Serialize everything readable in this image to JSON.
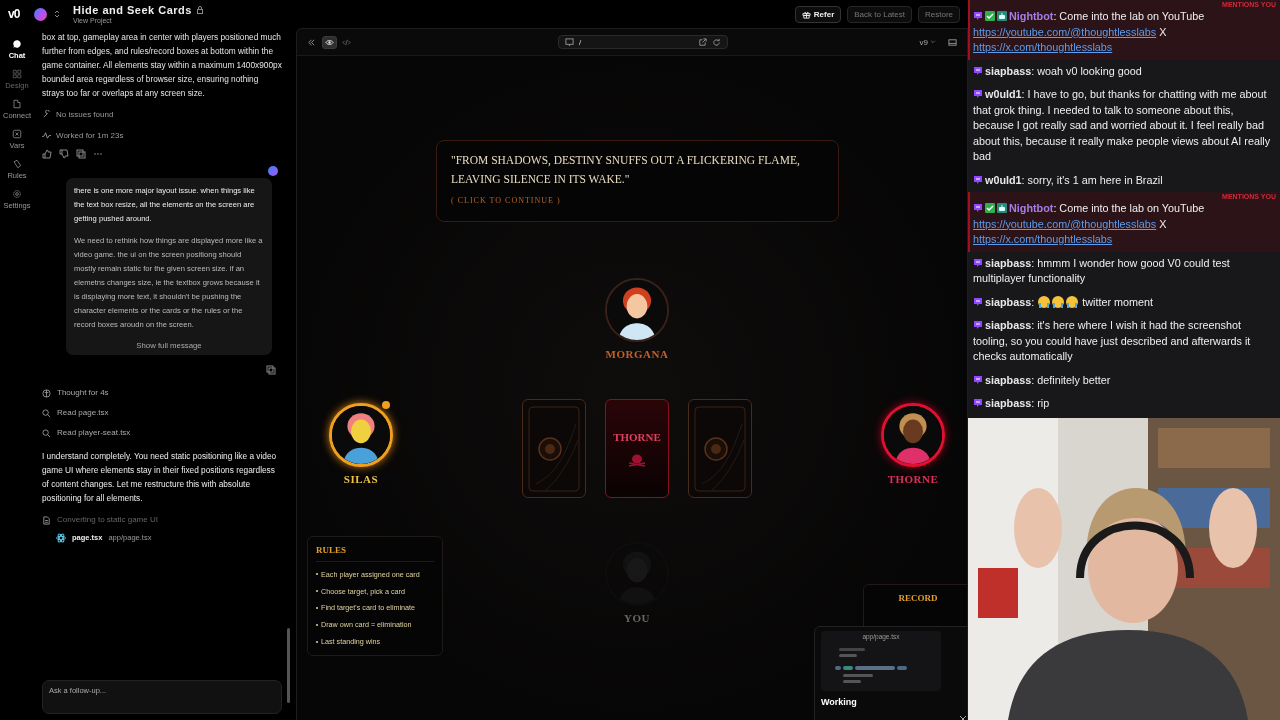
{
  "header": {
    "logo": "v0",
    "project_title": "Hide and Seek Cards",
    "project_link": "View Project",
    "buttons": [
      {
        "label": "Refer",
        "kind": "gift",
        "disabled": false
      },
      {
        "label": "Back to Latest",
        "kind": "plain",
        "disabled": true
      },
      {
        "label": "Restore",
        "kind": "plain",
        "disabled": true
      }
    ]
  },
  "nav": [
    {
      "label": "Chat",
      "kind": "chat",
      "selected": true,
      "disabled": false
    },
    {
      "label": "Design",
      "kind": "design",
      "selected": false,
      "disabled": true
    },
    {
      "label": "Connect",
      "kind": "connect",
      "selected": false,
      "disabled": false
    },
    {
      "label": "Vars",
      "kind": "vars",
      "selected": false,
      "disabled": false
    },
    {
      "label": "Rules",
      "kind": "rules",
      "selected": false,
      "disabled": false
    },
    {
      "label": "Settings",
      "kind": "settings",
      "selected": false,
      "disabled": false
    }
  ],
  "chat": {
    "summary": "box at top, gameplay area in center with players positioned much further from edges, and rules/record boxes at bottom within the game container. All elements stay within a maximum 1400x900px bounded area regardless of browser size, ensuring nothing strays too far or overlaps at any screen size.",
    "status": [
      {
        "kind": "wrench",
        "text": "No issues found"
      },
      {
        "kind": "pulse",
        "text": "Worked for 1m 23s"
      }
    ],
    "user_message": {
      "paragraphs": [
        "there is one more major layout issue. when things like the text box resize, all the elements on the screen are getting pushed around.",
        "We need to rethink how things are displayed more like a video game. the ui on the screen positiong should mostly remain static for the given screen size. if an elemetns changes size, ie the textbox grows because it is displaying more text, it shouldn't be pushing the character elements or the cards or the rules or the record boxes aroudn on the screen."
      ],
      "show_more": "Show full message"
    },
    "steps": [
      {
        "kind": "thought",
        "text": "Thought for 4s"
      },
      {
        "kind": "read",
        "text": "Read page.tsx"
      },
      {
        "kind": "read",
        "text": "Read player-seat.tsx"
      }
    ],
    "reply": "I understand completely. You need static positioning like a video game UI where elements stay in their fixed positions regardless of content changes. Let me restructure this with absolute positioning for all elements.",
    "task": {
      "title": "Converting to static game UI",
      "file": "page.tsx",
      "path": "app/page.tsx"
    },
    "input": {
      "placeholder": "Ask a follow-up..."
    }
  },
  "preview": {
    "view_modes": [
      {
        "kind": "preview",
        "selected": true
      },
      {
        "kind": "code",
        "selected": false
      }
    ],
    "path": "/",
    "version": "v9"
  },
  "game": {
    "narration": {
      "quote": "\"FROM SHADOWS, DESTINY SNUFFS OUT A FLICKERING FLAME, LEAVING SILENCE IN ITS WAKE.\"",
      "prompt": "( CLICK TO CONTINUE )"
    },
    "players": [
      {
        "name": "MORGANA",
        "kind": "idle"
      },
      {
        "name": "SILAS",
        "kind": "turn"
      },
      {
        "name": "THORNE",
        "kind": "target"
      },
      {
        "name": "YOU",
        "kind": "out"
      }
    ],
    "cards": [
      {
        "revealed": false
      },
      {
        "revealed": true,
        "label": "THORNE"
      },
      {
        "revealed": false
      }
    ],
    "rules": {
      "title": "RULES",
      "items": [
        "Each player assigned one card",
        "Choose target, pick a card",
        "Find target's card to eliminate",
        "Draw own card = elimination",
        "Last standing wins"
      ]
    },
    "record": {
      "title": "RECORD"
    },
    "toast": {
      "title": "Working",
      "file": "app/page.tsx"
    }
  },
  "stream_chat": [
    {
      "user": "Nightbot",
      "color": "#a77ee8",
      "badges": [
        {
          "kind": "sub"
        },
        {
          "kind": "verified"
        },
        {
          "kind": "bot"
        }
      ],
      "mention_label": "MENTIONS YOU",
      "parts": [
        {
          "kind": "text",
          "text": ": Come into the lab on YouTube "
        },
        {
          "kind": "link",
          "text": "https://youtube.com/@thoughtlesslabs"
        },
        {
          "kind": "text",
          "text": " X "
        },
        {
          "kind": "link",
          "text": "https://x.com/thoughtlesslabs"
        }
      ]
    },
    {
      "user": "siapbass",
      "color": "#e8e8ec",
      "badges": [
        {
          "kind": "sub"
        }
      ],
      "parts": [
        {
          "kind": "text",
          "text": ": woah v0 looking good"
        }
      ]
    },
    {
      "user": "w0uld1",
      "color": "#e8e8ec",
      "badges": [
        {
          "kind": "sub"
        }
      ],
      "parts": [
        {
          "kind": "text",
          "text": ": I have to go, but thanks for chatting with me about that grok thing. I needed to talk to someone about this, because I got really sad and worried about it. I feel really bad about this, because it really make people views about AI really bad"
        }
      ]
    },
    {
      "user": "w0uld1",
      "color": "#e8e8ec",
      "badges": [
        {
          "kind": "sub"
        }
      ],
      "parts": [
        {
          "kind": "text",
          "text": ": sorry, it's 1 am here in Brazil"
        }
      ]
    },
    {
      "user": "Nightbot",
      "color": "#a77ee8",
      "badges": [
        {
          "kind": "sub"
        },
        {
          "kind": "verified"
        },
        {
          "kind": "bot"
        }
      ],
      "mention_label": "MENTIONS YOU",
      "parts": [
        {
          "kind": "text",
          "text": ": Come into the lab on YouTube "
        },
        {
          "kind": "link",
          "text": "https://youtube.com/@thoughtlesslabs"
        },
        {
          "kind": "text",
          "text": " X "
        },
        {
          "kind": "link",
          "text": "https://x.com/thoughtlesslabs"
        }
      ]
    },
    {
      "user": "siapbass",
      "color": "#e8e8ec",
      "badges": [
        {
          "kind": "sub"
        }
      ],
      "parts": [
        {
          "kind": "text",
          "text": ": hmmm I wonder how good V0 could test multiplayer functionality"
        }
      ]
    },
    {
      "user": "siapbass",
      "color": "#e8e8ec",
      "badges": [
        {
          "kind": "sub"
        }
      ],
      "parts": [
        {
          "kind": "text",
          "text": ": "
        },
        {
          "kind": "emote"
        },
        {
          "kind": "emote"
        },
        {
          "kind": "emote"
        },
        {
          "kind": "text",
          "text": " twitter moment"
        }
      ]
    },
    {
      "user": "siapbass",
      "color": "#e8e8ec",
      "badges": [
        {
          "kind": "sub"
        }
      ],
      "parts": [
        {
          "kind": "text",
          "text": ": it's here where I wish it had the screenshot tooling, so you could have just described and afterwards it checks automatically"
        }
      ]
    },
    {
      "user": "siapbass",
      "color": "#e8e8ec",
      "badges": [
        {
          "kind": "sub"
        }
      ],
      "parts": [
        {
          "kind": "text",
          "text": ": definitely better"
        }
      ]
    },
    {
      "user": "siapbass",
      "color": "#e8e8ec",
      "badges": [
        {
          "kind": "sub"
        }
      ],
      "parts": [
        {
          "kind": "text",
          "text": ": rip"
        }
      ]
    }
  ]
}
